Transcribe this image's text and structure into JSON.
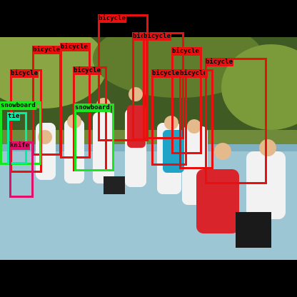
{
  "image": {
    "description": "Group of children in sports clothes standing on a blue hard tennis court, some holding rackets, trees and fence behind, with object-detection bounding boxes overlaid"
  },
  "colors": {
    "bicycle": "#e8110f",
    "snowboard": "#19e61e",
    "tie": "#00f0a0",
    "knife": "#e0106a"
  },
  "detections": [
    {
      "label": "bicycle",
      "color_key": "bicycle"
    },
    {
      "label": "bicycle",
      "color_key": "bicycle"
    },
    {
      "label": "bicycle",
      "color_key": "bicycle"
    },
    {
      "label": "bicycle",
      "color_key": "bicycle"
    },
    {
      "label": "bicycle",
      "color_key": "bicycle"
    },
    {
      "label": "bicycle",
      "color_key": "bicycle"
    },
    {
      "label": "bicycle",
      "color_key": "bicycle"
    },
    {
      "label": "bicycle",
      "color_key": "bicycle"
    },
    {
      "label": "bicycle",
      "color_key": "bicycle"
    },
    {
      "label": "bicycle",
      "color_key": "bicycle"
    },
    {
      "label": "bicycle",
      "color_key": "bicycle"
    },
    {
      "label": "snowboard",
      "color_key": "snowboard"
    },
    {
      "label": "snowboard",
      "color_key": "snowboard"
    },
    {
      "label": "tie",
      "color_key": "tie"
    },
    {
      "label": "knife",
      "color_key": "knife"
    }
  ]
}
